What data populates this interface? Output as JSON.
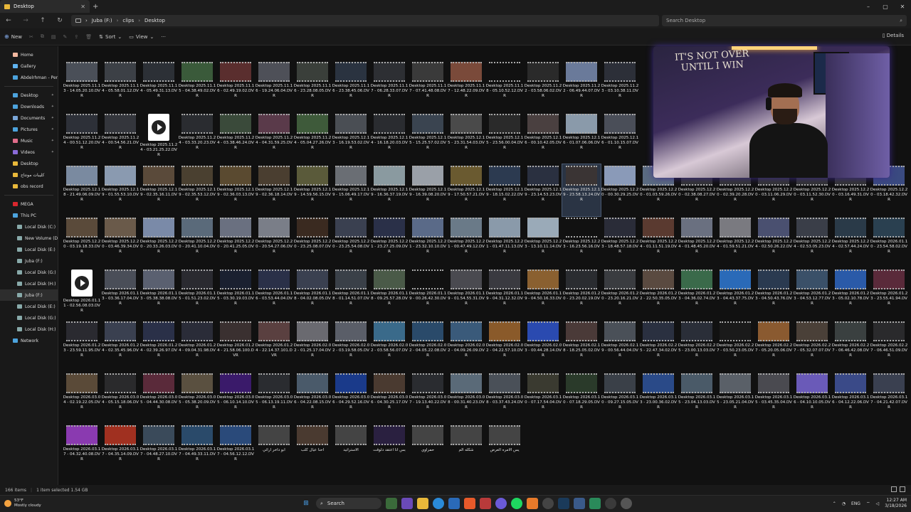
{
  "window": {
    "tab_title": "Desktop",
    "new_tab": "+",
    "minimize": "–",
    "maximize": "▢",
    "close": "✕"
  },
  "address": {
    "segments": [
      "Juba (F:)",
      "clips",
      "Desktop"
    ],
    "separator": "›",
    "search_placeholder": "Search Desktop"
  },
  "toolbar": {
    "new": "New",
    "sort": "Sort",
    "view": "View",
    "more": "···",
    "details": "Details"
  },
  "sidebar": {
    "quick": [
      {
        "label": "Home",
        "color": "#f2b8a0"
      },
      {
        "label": "Gallery",
        "color": "#5fb3f0"
      },
      {
        "label": "Abdelrhman - Personal",
        "color": "#4ca3dd"
      }
    ],
    "pinned": [
      {
        "label": "Desktop",
        "color": "#4ca3dd",
        "pin": true
      },
      {
        "label": "Downloads",
        "color": "#4ca3dd",
        "pin": true
      },
      {
        "label": "Documents",
        "color": "#7aa6d8",
        "pin": true
      },
      {
        "label": "Pictures",
        "color": "#4ca3dd",
        "pin": true
      },
      {
        "label": "Music",
        "color": "#e06c8a",
        "pin": true
      },
      {
        "label": "Videos",
        "color": "#8b6bd8",
        "pin": true
      },
      {
        "label": "Desktop",
        "color": "#e8b83a",
        "pin": false
      },
      {
        "label": "كليبات مونتاج",
        "color": "#e8b83a",
        "pin": false
      },
      {
        "label": "obs record",
        "color": "#e8b83a",
        "pin": false
      }
    ],
    "drives": [
      {
        "label": "MEGA",
        "color": "#d9272e"
      },
      {
        "label": "This PC",
        "color": "#4ca3dd"
      },
      {
        "label": "Local Disk (C:)",
        "color": "#8aa"
      },
      {
        "label": "New Volume (D:)",
        "color": "#8aa"
      },
      {
        "label": "Local Disk (E:)",
        "color": "#8aa"
      },
      {
        "label": "Juba (F:)",
        "color": "#8aa"
      },
      {
        "label": "Local Disk (G:)",
        "color": "#8aa"
      },
      {
        "label": "Local Disk (H:)",
        "color": "#8aa"
      },
      {
        "label": "Juba (F:)",
        "color": "#8aa",
        "selected": true
      },
      {
        "label": "Local Disk (E:)",
        "color": "#8aa"
      },
      {
        "label": "Local Disk (G:)",
        "color": "#8aa"
      },
      {
        "label": "Local Disk (H:)",
        "color": "#8aa"
      },
      {
        "label": "Network",
        "color": "#4ca3dd"
      }
    ]
  },
  "files": [
    {
      "name": "Desktop 2025.11.13 - 14.05.20.10.DVR",
      "color": "#4a4f58"
    },
    {
      "name": "Desktop 2025.11.14 - 05.58.01.12.DVR",
      "color": "#3c4046"
    },
    {
      "name": "Desktop 2025.11.14 - 05.49.31.13.DVR",
      "color": "#2c3036"
    },
    {
      "name": "Desktop 2025.11.15 - 04.38.49.02.DVR",
      "color": "#3a5a3a"
    },
    {
      "name": "Desktop 2025.11.16 - 02.49.19.02.DVR",
      "color": "#5a2e2e"
    },
    {
      "name": "Desktop 2025.11.16 - 19.24.06.04.DVR",
      "color": "#4e5058"
    },
    {
      "name": "Desktop 2025.11.16 - 23.28.08.05.DVR",
      "color": "#3a3f3a"
    },
    {
      "name": "Desktop 2025.11.16 - 23.38.45.06.DVR",
      "color": "#2a3340"
    },
    {
      "name": "Desktop 2025.11.17 - 06.28.33.07.DVR",
      "color": "#2d2f33"
    },
    {
      "name": "Desktop 2025.11.17 - 07.41.48.08.DVR",
      "color": "#3a3a3a"
    },
    {
      "name": "Desktop 2025.11.17 - 12.48.22.09.DVR",
      "color": "#7a4a3a"
    },
    {
      "name": "Desktop 2025.11.18 - 05.10.52.12.DVR",
      "color": "#111"
    },
    {
      "name": "Desktop 2025.11.22 - 03.58.06.02.DVR",
      "color": "#2a2a2a"
    },
    {
      "name": "Desktop 2025.11.22 - 06.49.44.07.DVR",
      "color": "#6a7a9a"
    },
    {
      "name": "Desktop 2025.11.23 - 03.10.38.11.DVR",
      "color": "#2c2f38"
    },
    {
      "name": "",
      "color": "#111"
    },
    {
      "name": "",
      "color": "#111"
    },
    {
      "name": "",
      "color": "#111"
    },
    {
      "name": "",
      "color": "#111"
    },
    {
      "name": "",
      "color": "#111"
    },
    {
      "name": "",
      "color": "#111"
    },
    {
      "name": "",
      "color": "#111"
    },
    {
      "name": "Desktop 2025.11.24 - 00.51.12.20.DVR",
      "color": "#2d3038"
    },
    {
      "name": "Desktop 2025.11.24 - 00.54.56.21.DVR",
      "color": "#34363c"
    },
    {
      "name": "Desktop 2025.11.24 - 03.21.25.22.DVR",
      "play": true
    },
    {
      "name": "Desktop 2025.11.24 - 03.33.20.23.DVR",
      "color": "#2a2c30"
    },
    {
      "name": "Desktop 2025.11.24 - 03.38.46.24.DVR",
      "color": "#3a4a3a"
    },
    {
      "name": "Desktop 2025.11.24 - 04.31.59.25.DVR",
      "color": "#5a3a4a"
    },
    {
      "name": "Desktop 2025.11.24 - 05.04.27.26.DVR",
      "color": "#3e5a3a"
    },
    {
      "name": "Desktop 2025.12.13 - 16.19.53.02.DVR",
      "color": "#4a4e54"
    },
    {
      "name": "Desktop 2025.12.14 - 16.18.20.03.DVR",
      "color": "#2a2c30"
    },
    {
      "name": "Desktop 2025.12.15 - 15.25.57.02.DVR",
      "color": "#3a4450"
    },
    {
      "name": "Desktop 2025.12.15 - 23.31.54.03.DVR",
      "color": "#4a4a4a"
    },
    {
      "name": "Desktop 2025.12.15 - 23.56.00.04.DVR",
      "color": "#2a2a2a"
    },
    {
      "name": "Desktop 2025.12.16 - 00.10.42.05.DVR",
      "color": "#4a4040"
    },
    {
      "name": "Desktop 2025.12.16 - 01.07.06.06.DVR",
      "color": "#8a9aaa"
    },
    {
      "name": "Desktop 2025.12.16 - 01.10.15.07.DVR",
      "color": "#4a4e58"
    },
    {
      "name": "",
      "color": "#111"
    },
    {
      "name": "",
      "color": "#111"
    },
    {
      "name": "",
      "color": "#111"
    },
    {
      "name": "",
      "color": "#111"
    },
    {
      "name": "",
      "color": "#111"
    },
    {
      "name": "",
      "color": "#111"
    },
    {
      "name": "",
      "color": "#111"
    },
    {
      "name": "Desktop 2025.12.18 - 21.49.06.09.DVR",
      "color": "#7a8aa0"
    },
    {
      "name": "Desktop 2025.12.19 - 01.55.53.10.DVR",
      "color": "#8a9ab0"
    },
    {
      "name": "Desktop 2025.12.19 - 02.35.16.11.DVR",
      "color": "#5a4a3a"
    },
    {
      "name": "Desktop 2025.12.19 - 02.35.53.12.DVR",
      "color": "#4a4030"
    },
    {
      "name": "Desktop 2025.12.19 - 02.36.03.13.DVR",
      "color": "#5a4a30"
    },
    {
      "name": "Desktop 2025.12.19 - 02.36.18.14.DVR",
      "color": "#4a3e30"
    },
    {
      "name": "Desktop 2025.12.19 - 14.59.56.15.DVR",
      "color": "#5a5a3a"
    },
    {
      "name": "Desktop 2025.12.19 - 15.06.49.17.DVR",
      "color": "#6a6e74"
    },
    {
      "name": "Desktop 2025.12.19 - 16.36.37.19.DVR",
      "color": "#8a9aa0"
    },
    {
      "name": "Desktop 2025.12.19 - 16.39.08.20.DVR",
      "color": "#9aa0a8"
    },
    {
      "name": "Desktop 2025.12.19 - 17.50.57.21.DVR",
      "color": "#6a5a30"
    },
    {
      "name": "Desktop 2025.12.19 - 18.15.02.22.DVR",
      "color": "#2c3a50"
    },
    {
      "name": "Desktop 2025.12.19 - 23.14.53.23.DVR",
      "color": "#2a3040"
    },
    {
      "name": "Desktop 2025.12.19 - 23.58.13.24.DVR",
      "color": "#3a3434",
      "selected": true
    },
    {
      "name": "Desktop 2025.12.20 - 00.30.29.25.DVR",
      "color": "#8a9ab8"
    },
    {
      "name": "Desktop 2025.12.20 - 01.03.59.26.DVR",
      "color": "#5a6a80"
    },
    {
      "name": "Desktop 2025.12.20 - 02.38.08.27.DVR",
      "color": "#333"
    },
    {
      "name": "Desktop 2025.12.20 - 02.39.20.28.DVR",
      "color": "#333"
    },
    {
      "name": "Desktop 2025.12.20 - 03.11.06.29.DVR",
      "color": "#333"
    },
    {
      "name": "Desktop 2025.12.20 - 03.11.52.30.DVR",
      "color": "#333"
    },
    {
      "name": "Desktop 2025.12.20 - 03.16.49.31.DVR",
      "color": "#333"
    },
    {
      "name": "Desktop 2025.12.20 - 03.18.42.32.DVR",
      "color": "#3a4a80"
    },
    {
      "name": "Desktop 2025.12.20 - 03.19.18.33.DVR",
      "color": "#5a4a3a"
    },
    {
      "name": "Desktop 2025.12.20 - 03.46.39.34.DVR",
      "color": "#6a5a4a"
    },
    {
      "name": "Desktop 2025.12.20 - 20.33.26.03.DVR",
      "color": "#7a8aa8"
    },
    {
      "name": "Desktop 2025.12.20 - 20.41.10.04.DVR",
      "color": "#5a6a7a"
    },
    {
      "name": "Desktop 2025.12.20 - 20.41.25.05.DVR",
      "color": "#6a7080"
    },
    {
      "name": "Desktop 2025.12.20 - 20.54.27.06.DVR",
      "color": "#7a7e88"
    },
    {
      "name": "Desktop 2025.12.20 - 23.25.08.07.DVR",
      "color": "#3a2a20"
    },
    {
      "name": "Desktop 2025.12.20 - 23.25.54.08.DVR",
      "color": "#3a4050"
    },
    {
      "name": "Desktop 2025.12.21 - 23.27.25.09.DVR",
      "color": "#2a3048"
    },
    {
      "name": "Desktop 2025.12.21 - 23.32.10.10.DVR",
      "color": "#5a6a88"
    },
    {
      "name": "Desktop 2025.12.21 - 00.47.49.12.DVR",
      "color": "#6a7a88"
    },
    {
      "name": "Desktop 2025.12.21 - 01.47.11.13.DVR",
      "color": "#8a9aaa"
    },
    {
      "name": "Desktop 2025.12.23 - 13.10.11.14.DVR",
      "color": "#9aaab8"
    },
    {
      "name": "Desktop 2025.12.23 - 16.23.56.16.DVR",
      "color": "#111"
    },
    {
      "name": "Desktop 2025.12.23 - 18.48.57.18.DVR",
      "color": "#2a2c38"
    },
    {
      "name": "Desktop 2025.12.24 - 01.11.51.19.DVR",
      "color": "#5a3a30"
    },
    {
      "name": "Desktop 2025.12.24 - 01.48.45.20.DVR",
      "color": "#6a7080"
    },
    {
      "name": "Desktop 2025.12.24 - 01.59.51.21.DVR",
      "color": "#7a7a80"
    },
    {
      "name": "Desktop 2025.12.24 - 02.50.26.22.DVR",
      "color": "#4a5070"
    },
    {
      "name": "Desktop 2025.12.24 - 02.53.05.23.DVR",
      "color": "#3a3e48"
    },
    {
      "name": "Desktop 2025.12.24 - 02.57.44.24.DVR",
      "color": "#2a3a48"
    },
    {
      "name": "Desktop 2026.01.10 - 23.54.58.02.DVR",
      "color": "#2a4050"
    },
    {
      "name": "Desktop 2026.01.11 - 02.56.08.03.DVR",
      "play": true
    },
    {
      "name": "Desktop 2026.01.13 - 03.36.17.04.DVR",
      "color": "#4a4e58"
    },
    {
      "name": "Desktop 2026.01.13 - 05.38.38.08.DVR",
      "color": "#5a6070"
    },
    {
      "name": "Desktop 2026.01.15 - 01.51.23.02.DVR",
      "color": "#2a2a30"
    },
    {
      "name": "Desktop 2026.01.15 - 03.30.19.03.DVR",
      "color": "#1a2030"
    },
    {
      "name": "Desktop 2026.01.16 - 03.53.44.04.DVR",
      "color": "#2a3048"
    },
    {
      "name": "Desktop 2026.01.18 - 04.02.08.05.DVR",
      "color": "#3a4050"
    },
    {
      "name": "Desktop 2026.01.18 - 01.14.51.07.DVR",
      "color": "#3a4048"
    },
    {
      "name": "Desktop 2026.01.18 - 09.25.57.28.DVR",
      "color": "#4a5a48"
    },
    {
      "name": "Desktop 2026.01.19 - 00.26.42.30.DVR",
      "color": "#111"
    },
    {
      "name": "Desktop 2026.01.19 - 01.54.55.31.DVR",
      "color": "#4a4a50"
    },
    {
      "name": "Desktop 2026.01.19 - 04.31.12.32.DVR",
      "color": "#3a3a40"
    },
    {
      "name": "Desktop 2026.01.19 - 04.50.16.33.DVR",
      "color": "#8a6030"
    },
    {
      "name": "Desktop 2026.01.20 - 23.20.02.19.DVR",
      "color": "#2a2c30"
    },
    {
      "name": "Desktop 2026.01.20 - 23.20.16.21.DVR",
      "color": "#3a3c40"
    },
    {
      "name": "Desktop 2026.01.22 - 22.50.35.05.DVR",
      "color": "#5a4a40"
    },
    {
      "name": "Desktop 2026.01.23 - 04.36.02.74.DVR",
      "color": "#3a6a4a"
    },
    {
      "name": "Desktop 2026.01.23 - 04.43.37.75.DVR",
      "color": "#2a6ab8"
    },
    {
      "name": "Desktop 2026.01.23 - 04.50.43.76.DVR",
      "color": "#2a3a50"
    },
    {
      "name": "Desktop 2026.01.23 - 04.53.12.77.DVR",
      "color": "#3a5068"
    },
    {
      "name": "Desktop 2026.01.23 - 05.02.10.78.DVR",
      "color": "#2a5aa8"
    },
    {
      "name": "Desktop 2026.01.23 - 23.55.41.94.DVR",
      "color": "#5a2a3a"
    },
    {
      "name": "Desktop 2026.01.23 - 23.59.11.95.DVR",
      "color": "#2a2a30"
    },
    {
      "name": "Desktop 2026.01.24 - 02.35.45.96.DVR",
      "color": "#3a4050"
    },
    {
      "name": "Desktop 2026.01.24 - 02.39.26.97.DVR",
      "color": "#2a3048"
    },
    {
      "name": "Desktop 2026.01.24 - 09.04.31.98.DVR",
      "color": "#2a2c38"
    },
    {
      "name": "Desktop 2026.01.24 - 21.58.06.100.DVR",
      "color": "#3a3030"
    },
    {
      "name": "Desktop 2026.01.24 - 22.14.37.101.DVR",
      "color": "#5a4040"
    },
    {
      "name": "Desktop 2026.02.02 - 01.25.17.04.DVR",
      "color": "#6a6a70"
    },
    {
      "name": "Desktop 2026.02.02 - 03.19.58.05.DVR",
      "color": "#5a5e68"
    },
    {
      "name": "Desktop 2026.02.02 - 03.58.56.07.DVR",
      "color": "#3a6a8a"
    },
    {
      "name": "Desktop 2026.02.02 - 04.05.22.08.DVR",
      "color": "#2a4a6a"
    },
    {
      "name": "Desktop 2026.02.02 - 04.09.26.09.DVR",
      "color": "#3a5a7a"
    },
    {
      "name": "Desktop 2026.02.02 - 04.22.57.10.DVR",
      "color": "#8a5a2a"
    },
    {
      "name": "Desktop 2026.02.03 - 00.44.28.14.DVR",
      "color": "#2a4ab0"
    },
    {
      "name": "Desktop 2026.02.18 - 18.25.05.02.DVR",
      "color": "#4a3a38"
    },
    {
      "name": "Desktop 2026.02.19 - 00.56.44.04.DVR",
      "color": "#4a5058"
    },
    {
      "name": "Desktop 2026.02.25 - 22.47.34.02.DVR",
      "color": "#2a3040"
    },
    {
      "name": "Desktop 2026.02.25 - 23.00.13.03.DVR",
      "color": "#2a2e38"
    },
    {
      "name": "Desktop 2026.02.27 - 03.50.23.05.DVR",
      "color": "#1a1a1a"
    },
    {
      "name": "Desktop 2026.02.27 - 05.20.05.06.DVR",
      "color": "#8a5a30"
    },
    {
      "name": "Desktop 2026.02.27 - 05.32.07.07.DVR",
      "color": "#4a4038"
    },
    {
      "name": "Desktop 2026.02.27 - 06.46.42.08.DVR",
      "color": "#3a4040"
    },
    {
      "name": "Desktop 2026.02.27 - 06.46.51.09.DVR",
      "color": "#2a2a2c"
    },
    {
      "name": "Desktop 2026.03.04 - 02.19.22.05.DVR",
      "color": "#5a4a38"
    },
    {
      "name": "Desktop 2026.03.04 - 05.15.18.06.DVR",
      "color": "#2a2a2c"
    },
    {
      "name": "Desktop 2026.03.05 - 04.44.30.08.DVR",
      "color": "#5a2a3a"
    },
    {
      "name": "Desktop 2026.03.05 - 05.38.20.09.DVR",
      "color": "#5a5040"
    },
    {
      "name": "Desktop 2026.03.05 - 06.10.14.10.DVR",
      "color": "#3a1a6a"
    },
    {
      "name": "Desktop 2026.03.05 - 06.13.19.11.DVR",
      "color": "#2a2c30"
    },
    {
      "name": "Desktop 2026.03.06 - 04.22.08.15.DVR",
      "color": "#4a5a6a"
    },
    {
      "name": "Desktop 2026.03.06 - 04.29.52.16.DVR",
      "color": "#1a3a8a"
    },
    {
      "name": "Desktop 2026.03.06 - 04.30.25.17.DVR",
      "color": "#4a3a30"
    },
    {
      "name": "Desktop 2026.03.07 - 19.13.40.22.DVR",
      "color": "#2a2c30"
    },
    {
      "name": "Desktop 2026.03.08 - 00.31.40.23.DVR",
      "color": "#5a6a78"
    },
    {
      "name": "Desktop 2026.03.08 - 03.37.43.24.DVR",
      "color": "#4a5058"
    },
    {
      "name": "Desktop 2026.03.10 - 07.17.54.04.DVR",
      "color": "#3a3a30"
    },
    {
      "name": "Desktop 2026.03.10 - 07.18.29.05.DVR",
      "color": "#2a3a2a"
    },
    {
      "name": "Desktop 2026.03.10 - 09.27.15.05.DVR",
      "color": "#3a4048"
    },
    {
      "name": "Desktop 2026.03.13 - 23.00.36.02.DVR",
      "color": "#2a4a88"
    },
    {
      "name": "Desktop 2026.03.15 - 23.04.13.03.DVR",
      "color": "#4a5a68"
    },
    {
      "name": "Desktop 2026.03.15 - 23.05.21.04.DVR",
      "color": "#5a6068"
    },
    {
      "name": "Desktop 2026.03.15 - 03.45.35.04.DVR",
      "color": "#4a4a50"
    },
    {
      "name": "Desktop 2026.03.16 - 04.10.10.05.DVR",
      "color": "#6a5ab8"
    },
    {
      "name": "Desktop 2026.03.16 - 04.12.22.06.DVR",
      "color": "#3a4a88"
    },
    {
      "name": "Desktop 2026.03.17 - 04.21.42.07.DVR",
      "color": "#3a4050"
    },
    {
      "name": "Desktop 2026.03.17 - 04.32.40.08.DVR",
      "color": "#8a3ab0"
    },
    {
      "name": "Desktop 2026.03.17 - 04.35.14.09.DVR",
      "color": "#a03020"
    },
    {
      "name": "Desktop 2026.03.17 - 04.48.27.10.DVR",
      "color": "#3a4a5a"
    },
    {
      "name": "Desktop 2026.03.17 - 04.49.33.11.DVR",
      "color": "#2a4a6a"
    },
    {
      "name": "Desktop 2026.03.17 - 04.56.12.12.DVR",
      "color": "#2a4a7a"
    },
    {
      "name": "ابو داخر ارائي",
      "color": "#444"
    },
    {
      "name": "احنا عيال كلب",
      "color": "#4a3a30"
    },
    {
      "name": "الاستراتيد",
      "color": "#444"
    },
    {
      "name": "بس انا اعتقد دلوقت",
      "color": "#2a2040"
    },
    {
      "name": "حمراوي",
      "color": "#444"
    },
    {
      "name": "شكله الم",
      "color": "#444"
    },
    {
      "name": "يس الامره العرض",
      "color": "#444"
    }
  ],
  "status": {
    "items": "166 items",
    "selected": "1 item selected  1.54 GB"
  },
  "webcam": {
    "banner": "IT'S NOT OVER UNTIL I WIN"
  },
  "taskbar": {
    "temp": "53°F",
    "weather": "Mostly cloudy",
    "search": "Search",
    "lang": "ENG",
    "time": "12:27 AM",
    "date": "3/18/2026"
  }
}
